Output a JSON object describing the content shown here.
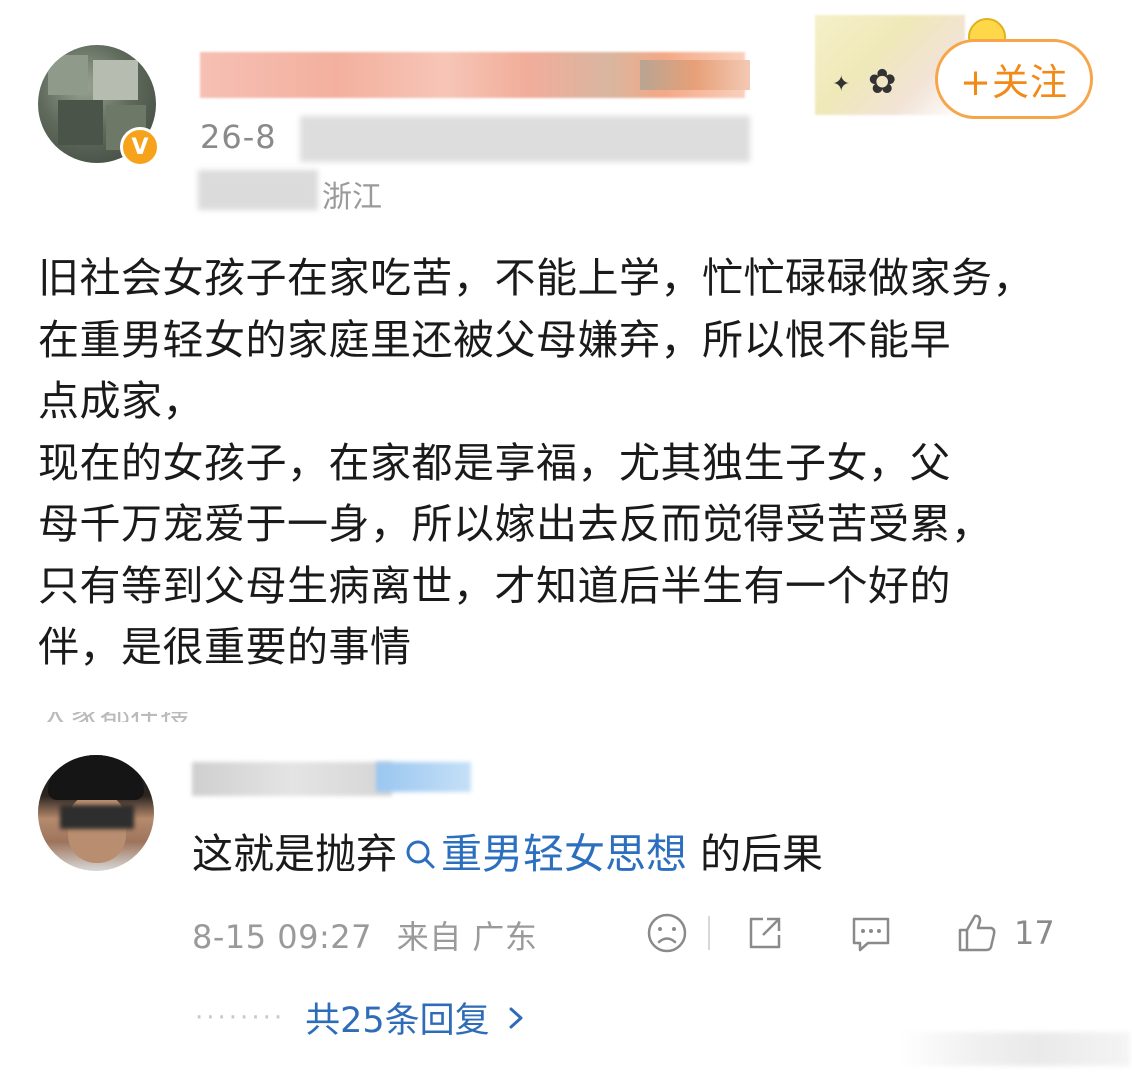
{
  "post": {
    "author_meta_visible": "26-8",
    "location_partial": "浙江",
    "follow_label": "+关注",
    "body": "旧社会女孩子在家吃苦，不能上学，忙忙碌碌做家务，\n在重男轻女的家庭里还被父母嫌弃，所以恨不能早\n点成家，\n现在的女孩子，在家都是享福，尤其独生子女，父\n母千万宠爱于一身，所以嫁出去反而觉得受苦受累，\n只有等到父母生病离世，才知道后半生有一个好的\n伴，是很重要的事情"
  },
  "comment": {
    "text_prefix": "这就是抛弃",
    "topic": "重男轻女思想",
    "text_suffix": " 的后果",
    "time": "8-15 09:27",
    "source": "来自 广东",
    "like_count": "17",
    "replies_label": "共25条回复"
  },
  "colors": {
    "accent_orange": "#f28a17",
    "link_blue": "#2d6fbf",
    "meta_gray": "#9a9a9a"
  }
}
